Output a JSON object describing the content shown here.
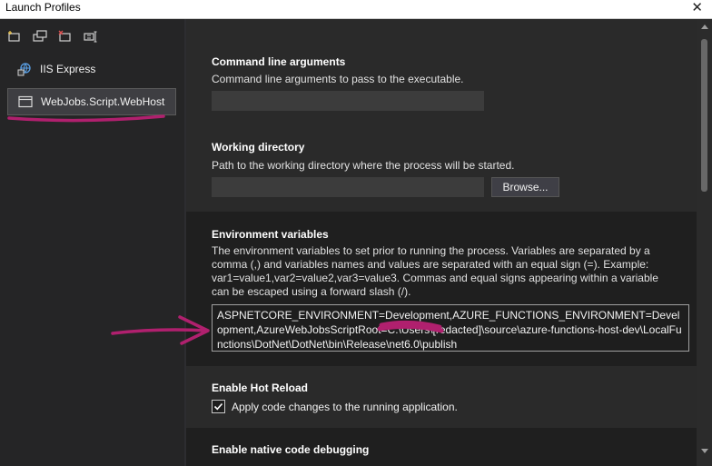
{
  "window": {
    "title": "Launch Profiles",
    "close_glyph": "✕"
  },
  "toolbar": {
    "icons": [
      "new-profile-icon",
      "duplicate-profile-icon",
      "delete-profile-icon",
      "rename-profile-icon"
    ]
  },
  "profiles": [
    {
      "label": "IIS Express",
      "icon": "globe-icon",
      "selected": false
    },
    {
      "label": "WebJobs.Script.WebHost",
      "icon": "window-icon",
      "selected": true
    }
  ],
  "sections": {
    "cmd_args": {
      "title": "Command line arguments",
      "description": "Command line arguments to pass to the executable.",
      "value": ""
    },
    "working_dir": {
      "title": "Working directory",
      "description": "Path to the working directory where the process will be started.",
      "value": "",
      "browse_label": "Browse..."
    },
    "env_vars": {
      "title": "Environment variables",
      "description": "The environment variables to set prior to running the process. Variables are separated by a comma (,) and variables names and values are separated with an equal sign (=). Example: var1=value1,var2=value2,var3=value3. Commas and equal signs appearing within a variable can be escaped using a forward slash (/).",
      "value": "ASPNETCORE_ENVIRONMENT=Development,AZURE_FUNCTIONS_ENVIRONMENT=Development,AzureWebJobsScriptRoot=C:\\Users\\[redacted]\\source\\azure-functions-host-dev\\LocalFunctions\\DotNet\\DotNet\\bin\\Release\\net6.0\\publish"
    },
    "hot_reload": {
      "title": "Enable Hot Reload",
      "checkbox_label": "Apply code changes to the running application.",
      "checked": true
    },
    "native_debug": {
      "title": "Enable native code debugging"
    }
  },
  "colors": {
    "annotation": "#b0206e",
    "selected_bg": "#3e3e42",
    "panel_bg": "#2a2a2a",
    "alt_bg": "#1f1f1f"
  }
}
